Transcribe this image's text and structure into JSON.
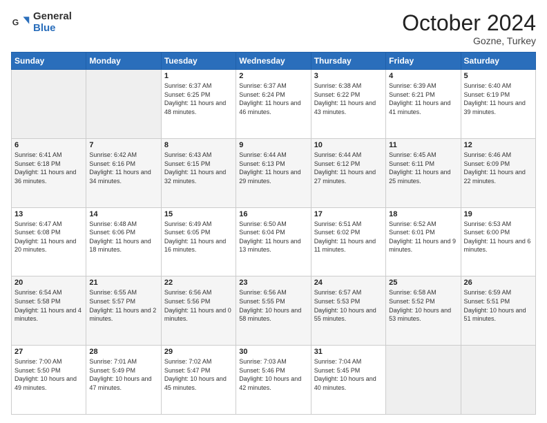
{
  "header": {
    "logo_general": "General",
    "logo_blue": "Blue",
    "title": "October 2024",
    "location": "Gozne, Turkey"
  },
  "weekdays": [
    "Sunday",
    "Monday",
    "Tuesday",
    "Wednesday",
    "Thursday",
    "Friday",
    "Saturday"
  ],
  "weeks": [
    [
      {
        "day": "",
        "info": ""
      },
      {
        "day": "",
        "info": ""
      },
      {
        "day": "1",
        "info": "Sunrise: 6:37 AM\nSunset: 6:25 PM\nDaylight: 11 hours and 48 minutes."
      },
      {
        "day": "2",
        "info": "Sunrise: 6:37 AM\nSunset: 6:24 PM\nDaylight: 11 hours and 46 minutes."
      },
      {
        "day": "3",
        "info": "Sunrise: 6:38 AM\nSunset: 6:22 PM\nDaylight: 11 hours and 43 minutes."
      },
      {
        "day": "4",
        "info": "Sunrise: 6:39 AM\nSunset: 6:21 PM\nDaylight: 11 hours and 41 minutes."
      },
      {
        "day": "5",
        "info": "Sunrise: 6:40 AM\nSunset: 6:19 PM\nDaylight: 11 hours and 39 minutes."
      }
    ],
    [
      {
        "day": "6",
        "info": "Sunrise: 6:41 AM\nSunset: 6:18 PM\nDaylight: 11 hours and 36 minutes."
      },
      {
        "day": "7",
        "info": "Sunrise: 6:42 AM\nSunset: 6:16 PM\nDaylight: 11 hours and 34 minutes."
      },
      {
        "day": "8",
        "info": "Sunrise: 6:43 AM\nSunset: 6:15 PM\nDaylight: 11 hours and 32 minutes."
      },
      {
        "day": "9",
        "info": "Sunrise: 6:44 AM\nSunset: 6:13 PM\nDaylight: 11 hours and 29 minutes."
      },
      {
        "day": "10",
        "info": "Sunrise: 6:44 AM\nSunset: 6:12 PM\nDaylight: 11 hours and 27 minutes."
      },
      {
        "day": "11",
        "info": "Sunrise: 6:45 AM\nSunset: 6:11 PM\nDaylight: 11 hours and 25 minutes."
      },
      {
        "day": "12",
        "info": "Sunrise: 6:46 AM\nSunset: 6:09 PM\nDaylight: 11 hours and 22 minutes."
      }
    ],
    [
      {
        "day": "13",
        "info": "Sunrise: 6:47 AM\nSunset: 6:08 PM\nDaylight: 11 hours and 20 minutes."
      },
      {
        "day": "14",
        "info": "Sunrise: 6:48 AM\nSunset: 6:06 PM\nDaylight: 11 hours and 18 minutes."
      },
      {
        "day": "15",
        "info": "Sunrise: 6:49 AM\nSunset: 6:05 PM\nDaylight: 11 hours and 16 minutes."
      },
      {
        "day": "16",
        "info": "Sunrise: 6:50 AM\nSunset: 6:04 PM\nDaylight: 11 hours and 13 minutes."
      },
      {
        "day": "17",
        "info": "Sunrise: 6:51 AM\nSunset: 6:02 PM\nDaylight: 11 hours and 11 minutes."
      },
      {
        "day": "18",
        "info": "Sunrise: 6:52 AM\nSunset: 6:01 PM\nDaylight: 11 hours and 9 minutes."
      },
      {
        "day": "19",
        "info": "Sunrise: 6:53 AM\nSunset: 6:00 PM\nDaylight: 11 hours and 6 minutes."
      }
    ],
    [
      {
        "day": "20",
        "info": "Sunrise: 6:54 AM\nSunset: 5:58 PM\nDaylight: 11 hours and 4 minutes."
      },
      {
        "day": "21",
        "info": "Sunrise: 6:55 AM\nSunset: 5:57 PM\nDaylight: 11 hours and 2 minutes."
      },
      {
        "day": "22",
        "info": "Sunrise: 6:56 AM\nSunset: 5:56 PM\nDaylight: 11 hours and 0 minutes."
      },
      {
        "day": "23",
        "info": "Sunrise: 6:56 AM\nSunset: 5:55 PM\nDaylight: 10 hours and 58 minutes."
      },
      {
        "day": "24",
        "info": "Sunrise: 6:57 AM\nSunset: 5:53 PM\nDaylight: 10 hours and 55 minutes."
      },
      {
        "day": "25",
        "info": "Sunrise: 6:58 AM\nSunset: 5:52 PM\nDaylight: 10 hours and 53 minutes."
      },
      {
        "day": "26",
        "info": "Sunrise: 6:59 AM\nSunset: 5:51 PM\nDaylight: 10 hours and 51 minutes."
      }
    ],
    [
      {
        "day": "27",
        "info": "Sunrise: 7:00 AM\nSunset: 5:50 PM\nDaylight: 10 hours and 49 minutes."
      },
      {
        "day": "28",
        "info": "Sunrise: 7:01 AM\nSunset: 5:49 PM\nDaylight: 10 hours and 47 minutes."
      },
      {
        "day": "29",
        "info": "Sunrise: 7:02 AM\nSunset: 5:47 PM\nDaylight: 10 hours and 45 minutes."
      },
      {
        "day": "30",
        "info": "Sunrise: 7:03 AM\nSunset: 5:46 PM\nDaylight: 10 hours and 42 minutes."
      },
      {
        "day": "31",
        "info": "Sunrise: 7:04 AM\nSunset: 5:45 PM\nDaylight: 10 hours and 40 minutes."
      },
      {
        "day": "",
        "info": ""
      },
      {
        "day": "",
        "info": ""
      }
    ]
  ]
}
